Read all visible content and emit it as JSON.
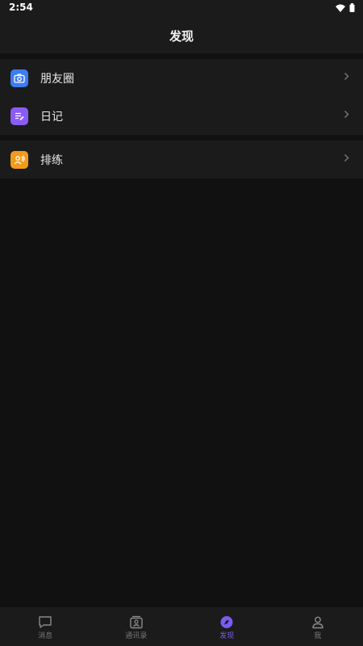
{
  "status": {
    "time": "2:54"
  },
  "header": {
    "title": "发现"
  },
  "groups": [
    {
      "items": [
        {
          "label": "朋友圈",
          "icon": "camera-icon",
          "color": "#3d7cf2"
        },
        {
          "label": "日记",
          "icon": "diary-icon",
          "color": "#8a5cf5"
        }
      ]
    },
    {
      "items": [
        {
          "label": "排练",
          "icon": "rehearsal-icon",
          "color": "#f29b1a"
        }
      ]
    }
  ],
  "tabs": [
    {
      "label": "消息",
      "icon": "chat-icon",
      "active": false
    },
    {
      "label": "通讯录",
      "icon": "contacts-icon",
      "active": false
    },
    {
      "label": "发现",
      "icon": "compass-icon",
      "active": true
    },
    {
      "label": "我",
      "icon": "person-icon",
      "active": false
    }
  ],
  "colors": {
    "accent": "#7b5cf0",
    "background": "#111111",
    "surface": "#1b1b1b"
  }
}
